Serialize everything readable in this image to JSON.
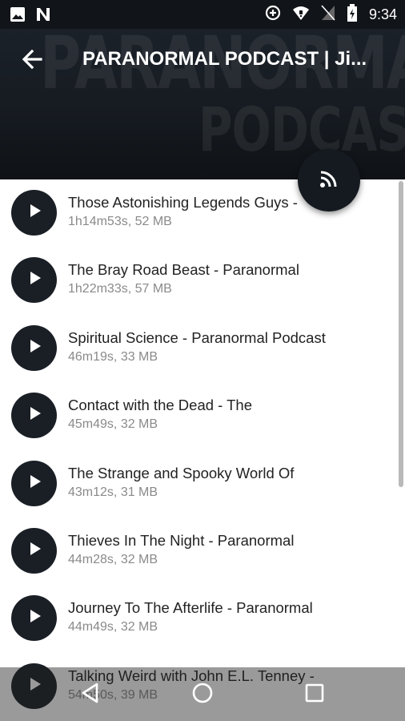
{
  "status_bar": {
    "time": "9:34",
    "left_icons": [
      "image-icon",
      "n-notification-icon"
    ],
    "right_icons": [
      "data-saver-icon",
      "wifi-icon",
      "no-sim-icon",
      "battery-charging-icon"
    ]
  },
  "header": {
    "title": "PARANORMAL PODCAST | Ji...",
    "artwork_text_line1": "PARANORMAL",
    "artwork_text_line2": "PODCAST",
    "back_icon": "arrow-left-icon",
    "subscribe_icon": "rss-feed-icon"
  },
  "episodes": [
    {
      "title": "Those Astonishing Legends Guys -",
      "meta": "1h14m53s, 52 MB"
    },
    {
      "title": "The Bray Road Beast - Paranormal",
      "meta": "1h22m33s, 57 MB"
    },
    {
      "title": "Spiritual Science - Paranormal Podcast",
      "meta": "46m19s, 33 MB"
    },
    {
      "title": "Contact with the Dead - The",
      "meta": "45m49s, 32 MB"
    },
    {
      "title": "The Strange and Spooky World Of",
      "meta": "43m12s, 31 MB"
    },
    {
      "title": "Thieves In The Night - Paranormal",
      "meta": "44m28s, 32 MB"
    },
    {
      "title": "Journey To The Afterlife - Paranormal",
      "meta": "44m49s, 32 MB"
    },
    {
      "title": "Talking Weird with John E.L. Tenney -",
      "meta": "54m50s, 39 MB"
    }
  ],
  "nav_bar": {
    "icons": [
      "back-triangle-icon",
      "home-circle-icon",
      "recents-square-icon"
    ]
  },
  "colors": {
    "header_bg": "#161b21",
    "play_button": "#1a1f26",
    "title_text": "#222222",
    "meta_text": "#8a8a8a"
  }
}
